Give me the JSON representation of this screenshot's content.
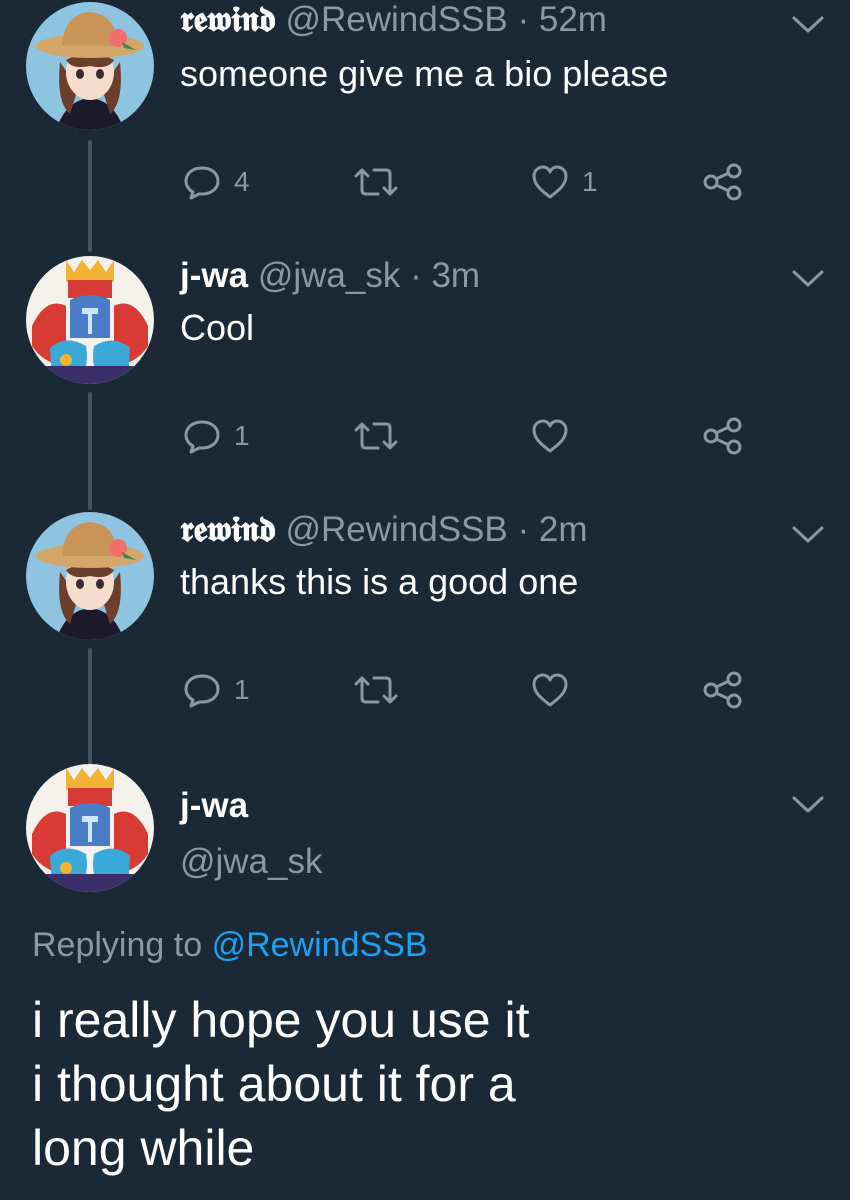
{
  "tweets": [
    {
      "display_name": "𝖗𝖊𝖜𝖎𝖓𝖉",
      "handle": "@RewindSSB",
      "time": "52m",
      "text": "someone give me a bio please",
      "reply_count": "4",
      "like_count": "1"
    },
    {
      "display_name": "j-wa",
      "handle": "@jwa_sk",
      "time": "3m",
      "text": "Cool",
      "reply_count": "1",
      "like_count": ""
    },
    {
      "display_name": "𝖗𝖊𝖜𝖎𝖓𝖉",
      "handle": "@RewindSSB",
      "time": "2m",
      "text": "thanks this is a good one",
      "reply_count": "1",
      "like_count": ""
    }
  ],
  "main_tweet": {
    "display_name": "j-wa",
    "handle": "@jwa_sk",
    "replying_prefix": "Replying to",
    "replying_to": "@RewindSSB",
    "lines": [
      "i really hope you use it",
      "i thought about it for a",
      "long while"
    ]
  },
  "separator": "·",
  "colors": {
    "background": "#1b2836",
    "secondary_text": "#8899a6",
    "link": "#1da1f2",
    "thread_line": "#3d5466"
  },
  "icons": [
    "reply-icon",
    "retweet-icon",
    "like-icon",
    "share-icon",
    "chevron-down-icon"
  ]
}
